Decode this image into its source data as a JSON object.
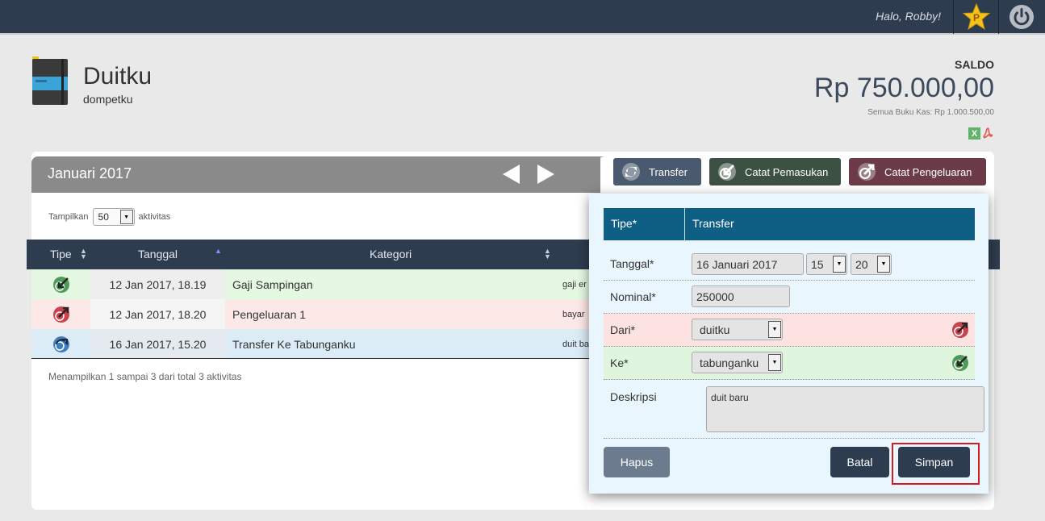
{
  "topbar": {
    "greeting": "Halo, Robby!",
    "star_icon": "premium-star-icon",
    "star_letter": "P",
    "power_icon": "power-icon"
  },
  "header": {
    "title": "Duitku",
    "subtitle": "dompetku",
    "saldo_label": "SALDO",
    "saldo_value": "Rp 750.000,00",
    "all_books": "Semua Buku Kas: Rp 1.000.500,00",
    "export_xls_letter": "X",
    "export_pdf_icon": "pdf-icon"
  },
  "period": {
    "label": "Januari 2017"
  },
  "actions": {
    "transfer": "Transfer",
    "pemasukan": "Catat Pemasukan",
    "pengeluaran": "Catat Pengeluaran"
  },
  "table_controls": {
    "show_prefix": "Tampilkan",
    "page_size": "50",
    "show_suffix": "aktivitas"
  },
  "table": {
    "columns": [
      "Tipe",
      "Tanggal",
      "Kategori"
    ],
    "rows": [
      {
        "type": "income",
        "date": "12 Jan 2017, 18.19",
        "category": "Gaji Sampingan",
        "desc": "gaji er"
      },
      {
        "type": "expense",
        "date": "12 Jan 2017, 18.20",
        "category": "Pengeluaran 1",
        "desc": "bayar"
      },
      {
        "type": "transfer",
        "date": "16 Jan 2017, 15.20",
        "category": "Transfer Ke Tabunganku",
        "desc": "duit ba"
      }
    ],
    "info": "Menampilkan 1 sampai 3 dari total 3 aktivitas"
  },
  "form": {
    "tipe_label": "Tipe*",
    "tipe_value": "Transfer",
    "tanggal_label": "Tanggal*",
    "tanggal_value": "16 Januari 2017",
    "hour": "15",
    "minute": "20",
    "nominal_label": "Nominal*",
    "nominal_value": "250000",
    "dari_label": "Dari*",
    "dari_value": "duitku",
    "ke_label": "Ke*",
    "ke_value": "tabunganku",
    "deskripsi_label": "Deskripsi",
    "deskripsi_value": "duit baru",
    "hapus": "Hapus",
    "batal": "Batal",
    "simpan": "Simpan"
  },
  "colors": {
    "topbar": "#2e3c4f",
    "income_row": "#e4f8e2",
    "expense_row": "#fde8e8",
    "transfer_row": "#dcecf7",
    "form_header": "#0f5f85",
    "highlight": "#d71920"
  }
}
